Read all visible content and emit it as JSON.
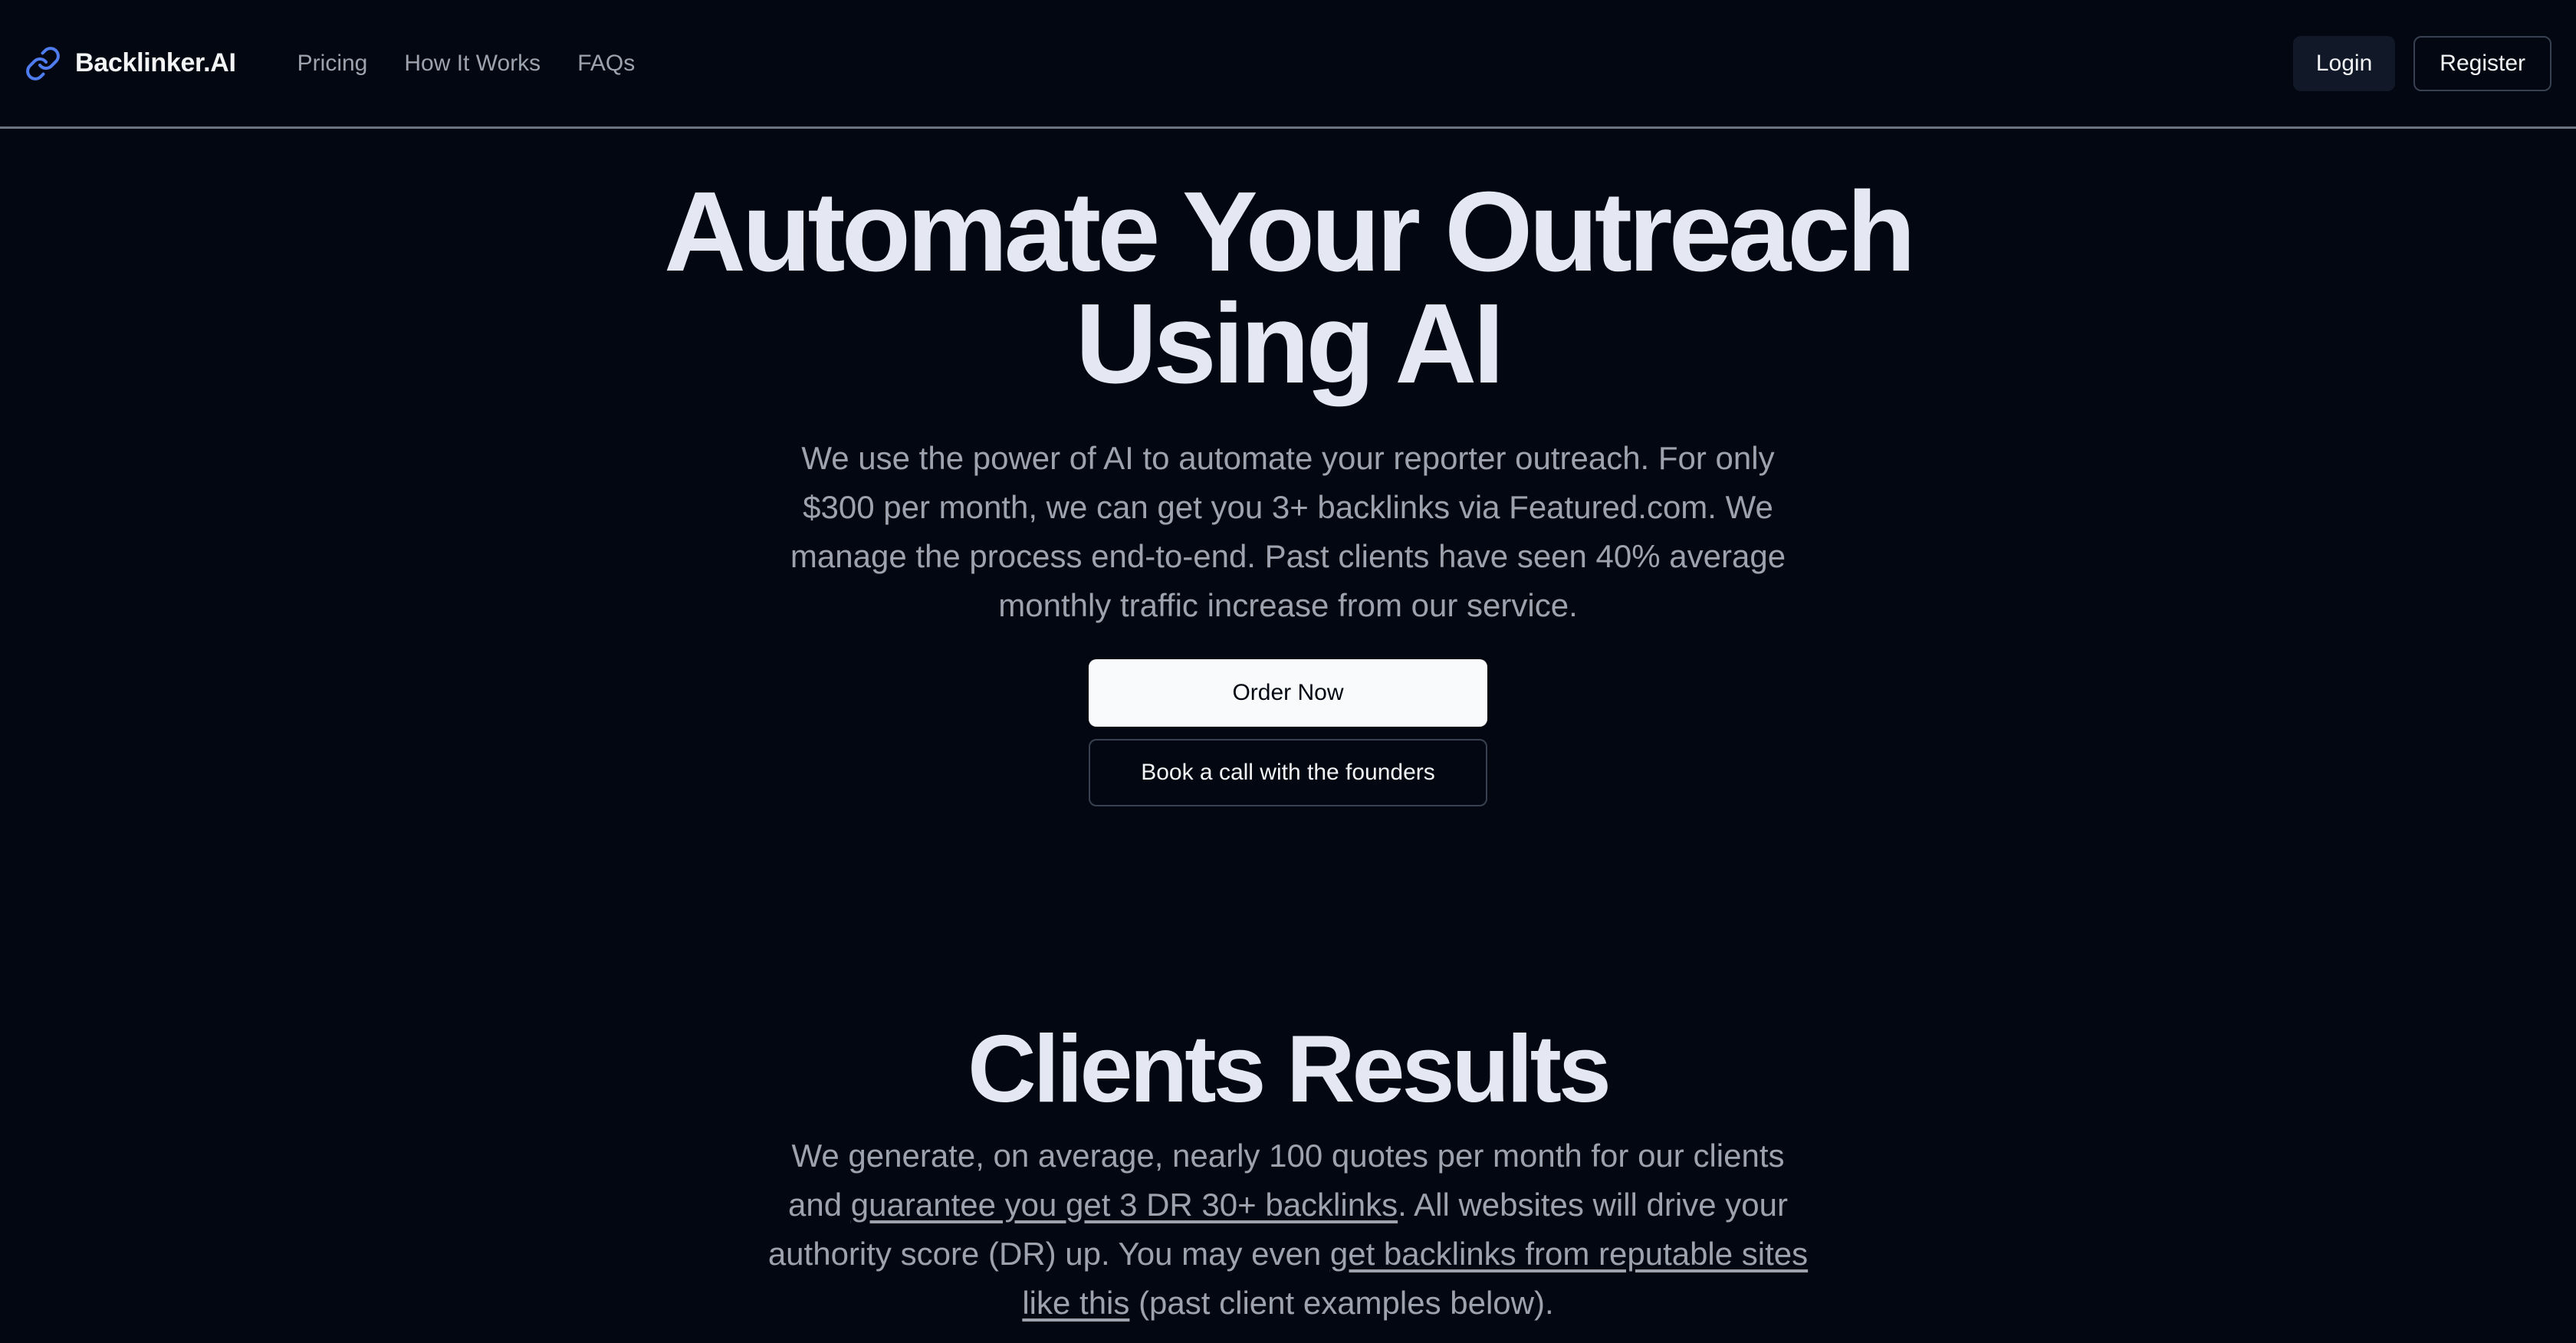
{
  "header": {
    "brand": "Backlinker.AI",
    "nav": [
      "Pricing",
      "How It Works",
      "FAQs"
    ],
    "login_label": "Login",
    "register_label": "Register"
  },
  "hero": {
    "title_line1": "Automate Your Outreach",
    "title_line2": "Using AI",
    "description": "We use the power of AI to automate your reporter outreach. For only $300 per month, we can get you 3+ backlinks via Featured.com. We manage the process end-to-end. Past clients have seen 40% average monthly traffic increase from our service.",
    "order_label": "Order Now",
    "call_label": "Book a call with the founders"
  },
  "results": {
    "title": "Clients Results",
    "text_1": "We generate, on average, nearly 100 quotes per month for our clients and ",
    "link_1": "guarantee you get 3 DR 30+ backlinks",
    "text_2": ". All websites will drive your authority score (DR) up. You may even ",
    "link_2": "get backlinks from reputable sites like this",
    "text_3": " (past client examples below)."
  },
  "colors": {
    "background": "#030712",
    "accent_icon": "#4f7df0",
    "muted_text": "#9ca3af",
    "title_text": "#e5e7f2"
  }
}
